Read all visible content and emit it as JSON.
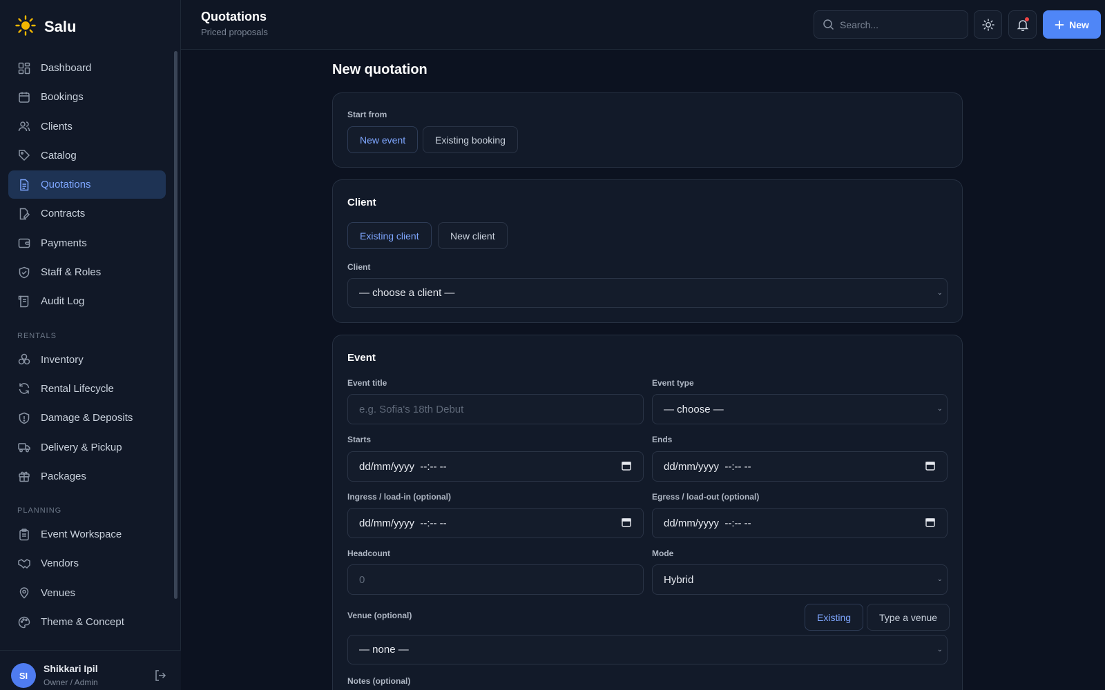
{
  "app": {
    "name": "Salu"
  },
  "sidebar": {
    "main": [
      {
        "label": "Dashboard",
        "icon": "dashboard-icon"
      },
      {
        "label": "Bookings",
        "icon": "calendar-icon"
      },
      {
        "label": "Clients",
        "icon": "users-icon"
      },
      {
        "label": "Catalog",
        "icon": "tag-icon"
      },
      {
        "label": "Quotations",
        "icon": "document-icon",
        "active": true
      },
      {
        "label": "Contracts",
        "icon": "contract-icon"
      },
      {
        "label": "Payments",
        "icon": "wallet-icon"
      },
      {
        "label": "Staff & Roles",
        "icon": "shield-icon"
      },
      {
        "label": "Audit Log",
        "icon": "scroll-icon"
      }
    ],
    "rentals_heading": "RENTALS",
    "rentals": [
      {
        "label": "Inventory",
        "icon": "boxes-icon"
      },
      {
        "label": "Rental Lifecycle",
        "icon": "refresh-icon"
      },
      {
        "label": "Damage & Deposits",
        "icon": "shield-alert-icon"
      },
      {
        "label": "Delivery & Pickup",
        "icon": "truck-icon"
      },
      {
        "label": "Packages",
        "icon": "gift-icon"
      }
    ],
    "planning_heading": "PLANNING",
    "planning": [
      {
        "label": "Event Workspace",
        "icon": "clipboard-icon"
      },
      {
        "label": "Vendors",
        "icon": "handshake-icon"
      },
      {
        "label": "Venues",
        "icon": "map-pin-icon"
      },
      {
        "label": "Theme & Concept",
        "icon": "palette-icon"
      }
    ],
    "user": {
      "initials": "SI",
      "name": "Shikkari Ipil",
      "role": "Owner / Admin"
    }
  },
  "header": {
    "title": "Quotations",
    "subtitle": "Priced proposals",
    "search_placeholder": "Search...",
    "new_label": "New"
  },
  "main": {
    "page_title": "New quotation",
    "start_from": {
      "label": "Start from",
      "options": [
        "New event",
        "Existing booking"
      ],
      "selected": "New event"
    },
    "client": {
      "title": "Client",
      "options": [
        "Existing client",
        "New client"
      ],
      "selected": "Existing client",
      "field_label": "Client",
      "field_value": "— choose a client —"
    },
    "event": {
      "title": "Event",
      "title_label": "Event title",
      "title_placeholder": "e.g. Sofia's 18th Debut",
      "type_label": "Event type",
      "type_value": "— choose —",
      "starts_label": "Starts",
      "starts_value": "dd/mm/yyyy  --:-- --",
      "ends_label": "Ends",
      "ends_value": "dd/mm/yyyy  --:-- --",
      "ingress_label": "Ingress / load-in (optional)",
      "ingress_value": "dd/mm/yyyy  --:-- --",
      "egress_label": "Egress / load-out (optional)",
      "egress_value": "dd/mm/yyyy  --:-- --",
      "headcount_label": "Headcount",
      "headcount_placeholder": "0",
      "mode_label": "Mode",
      "mode_value": "Hybrid",
      "venue_label": "Venue (optional)",
      "venue_options": [
        "Existing",
        "Type a venue"
      ],
      "venue_selected": "Existing",
      "venue_value": "— none —",
      "notes_label": "Notes (optional)"
    }
  }
}
